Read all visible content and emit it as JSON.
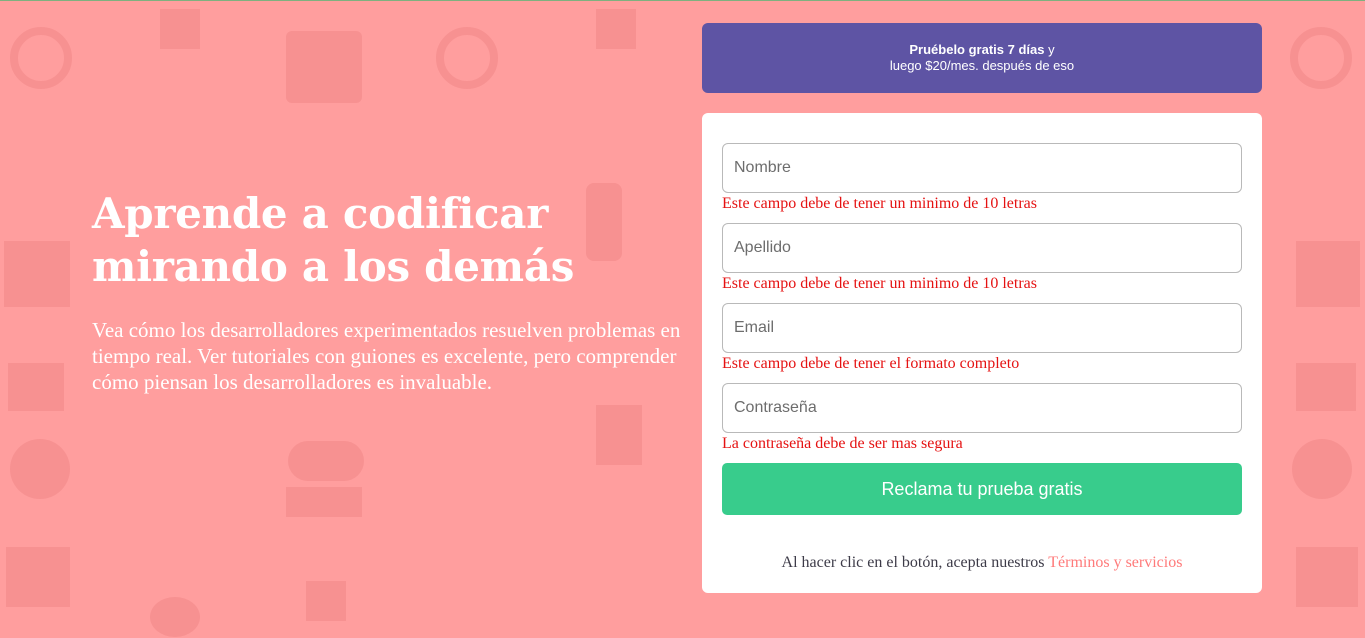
{
  "hero": {
    "title": "Aprende a codificar mirando a los demás",
    "description": "Vea cómo los desarrolladores experimentados resuelven problemas en tiempo real. Ver tutoriales con guiones es excelente, pero comprender cómo piensan los desarrolladores es invaluable."
  },
  "promo": {
    "highlight": "Pruébelo gratis 7 días",
    "suffix": " y",
    "line2": "luego $20/mes. después de eso"
  },
  "form": {
    "nombre": {
      "placeholder": "Nombre",
      "error": "Este campo debe de tener un minimo de 10 letras"
    },
    "apellido": {
      "placeholder": "Apellido",
      "error": "Este campo debe de tener un minimo de 10 letras"
    },
    "email": {
      "placeholder": "Email",
      "error": "Este campo debe de tener el formato completo"
    },
    "password": {
      "placeholder": "Contraseña",
      "error": "La contraseña debe de ser mas segura"
    },
    "submit_label": "Reclama tu prueba gratis",
    "terms_text": "Al hacer clic en el botón, acepta nuestros ",
    "terms_link": "Términos y servicios"
  },
  "colors": {
    "background": "#ff9e9e",
    "promo": "#5e54a4",
    "cta": "#38cc8c",
    "error": "#e51212",
    "link": "#ff7a7a"
  }
}
